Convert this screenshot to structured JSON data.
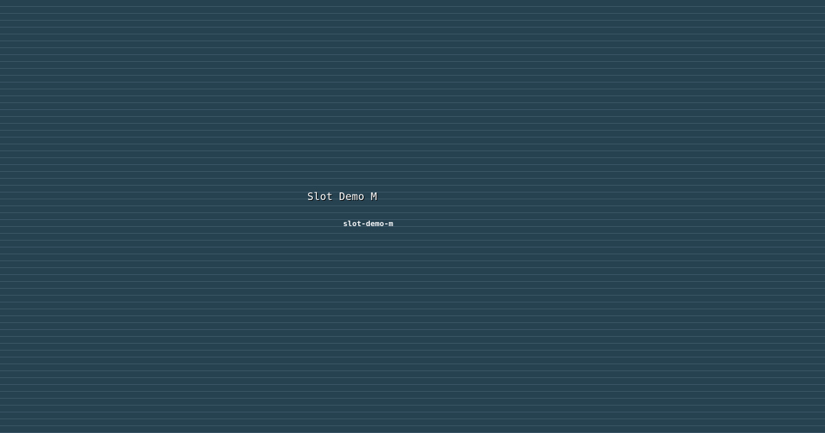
{
  "app": {
    "title": "Slot Demo M",
    "slug": "slot-demo-m"
  },
  "colors": {
    "background": "#264150",
    "scanline": "#4a6677",
    "text": "#ffffff",
    "shadow": "#000000"
  }
}
